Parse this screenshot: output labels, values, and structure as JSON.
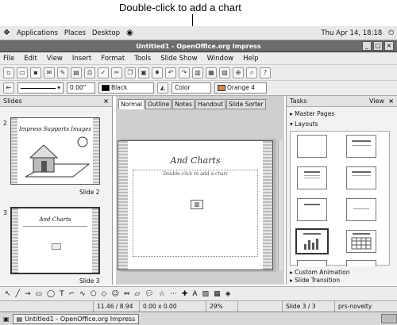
{
  "callout": {
    "text": "Double-click to add a chart"
  },
  "topbar": {
    "applications": "Applications",
    "places": "Places",
    "desktop": "Desktop",
    "clock": "Thu Apr 14, 18:18"
  },
  "window": {
    "title": "Untitled1 - OpenOffice.org Impress"
  },
  "menu": [
    "File",
    "Edit",
    "View",
    "Insert",
    "Format",
    "Tools",
    "Slide Show",
    "Window",
    "Help"
  ],
  "format_bar": {
    "line_width": "0.00\"",
    "line_color": "Black",
    "fill_type": "Color",
    "fill_color": "Orange 4"
  },
  "slides_pane": {
    "title": "Slides",
    "slides": [
      {
        "num": "2",
        "title": "Impress Supports Images",
        "caption": "Slide 2"
      },
      {
        "num": "3",
        "title": "And Charts",
        "caption": "Slide 3"
      }
    ]
  },
  "tabs": [
    "Normal",
    "Outline",
    "Notes",
    "Handout",
    "Slide Sorter"
  ],
  "slide": {
    "title": "And Charts",
    "placeholder": "Double-click to add a chart"
  },
  "tasks_pane": {
    "title": "Tasks",
    "view": "View",
    "sections": {
      "master_pages": "Master Pages",
      "layouts": "Layouts",
      "custom_animation": "Custom Animation",
      "slide_transition": "Slide Transition"
    }
  },
  "status": {
    "position": "11.46 / 8.94",
    "size": "0.00 x 0.00",
    "zoom": "29%",
    "slide": "Slide 3 / 3",
    "theme": "prs-novelty"
  },
  "taskbar": {
    "item": "Untitled1 - OpenOffice.org Impress"
  },
  "colors": {
    "titlebar": "#6c6c6c",
    "accent": "#a0a0a0"
  }
}
